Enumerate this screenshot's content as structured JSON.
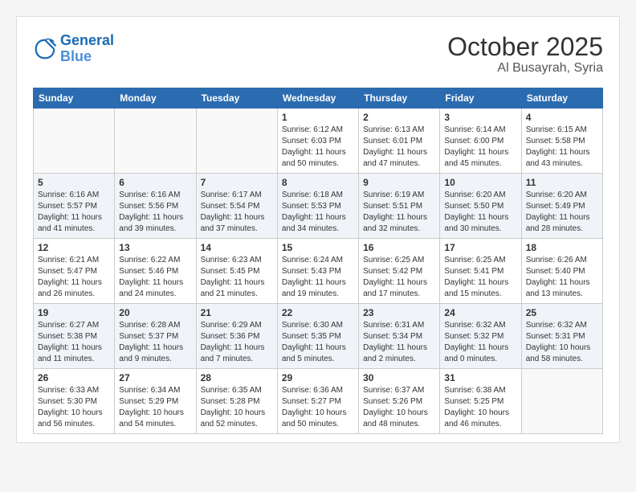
{
  "header": {
    "logo_line1": "General",
    "logo_line2": "Blue",
    "month": "October 2025",
    "location": "Al Busayrah, Syria"
  },
  "days_of_week": [
    "Sunday",
    "Monday",
    "Tuesday",
    "Wednesday",
    "Thursday",
    "Friday",
    "Saturday"
  ],
  "weeks": [
    [
      {
        "day": "",
        "content": ""
      },
      {
        "day": "",
        "content": ""
      },
      {
        "day": "",
        "content": ""
      },
      {
        "day": "1",
        "content": "Sunrise: 6:12 AM\nSunset: 6:03 PM\nDaylight: 11 hours and 50 minutes."
      },
      {
        "day": "2",
        "content": "Sunrise: 6:13 AM\nSunset: 6:01 PM\nDaylight: 11 hours and 47 minutes."
      },
      {
        "day": "3",
        "content": "Sunrise: 6:14 AM\nSunset: 6:00 PM\nDaylight: 11 hours and 45 minutes."
      },
      {
        "day": "4",
        "content": "Sunrise: 6:15 AM\nSunset: 5:58 PM\nDaylight: 11 hours and 43 minutes."
      }
    ],
    [
      {
        "day": "5",
        "content": "Sunrise: 6:16 AM\nSunset: 5:57 PM\nDaylight: 11 hours and 41 minutes."
      },
      {
        "day": "6",
        "content": "Sunrise: 6:16 AM\nSunset: 5:56 PM\nDaylight: 11 hours and 39 minutes."
      },
      {
        "day": "7",
        "content": "Sunrise: 6:17 AM\nSunset: 5:54 PM\nDaylight: 11 hours and 37 minutes."
      },
      {
        "day": "8",
        "content": "Sunrise: 6:18 AM\nSunset: 5:53 PM\nDaylight: 11 hours and 34 minutes."
      },
      {
        "day": "9",
        "content": "Sunrise: 6:19 AM\nSunset: 5:51 PM\nDaylight: 11 hours and 32 minutes."
      },
      {
        "day": "10",
        "content": "Sunrise: 6:20 AM\nSunset: 5:50 PM\nDaylight: 11 hours and 30 minutes."
      },
      {
        "day": "11",
        "content": "Sunrise: 6:20 AM\nSunset: 5:49 PM\nDaylight: 11 hours and 28 minutes."
      }
    ],
    [
      {
        "day": "12",
        "content": "Sunrise: 6:21 AM\nSunset: 5:47 PM\nDaylight: 11 hours and 26 minutes."
      },
      {
        "day": "13",
        "content": "Sunrise: 6:22 AM\nSunset: 5:46 PM\nDaylight: 11 hours and 24 minutes."
      },
      {
        "day": "14",
        "content": "Sunrise: 6:23 AM\nSunset: 5:45 PM\nDaylight: 11 hours and 21 minutes."
      },
      {
        "day": "15",
        "content": "Sunrise: 6:24 AM\nSunset: 5:43 PM\nDaylight: 11 hours and 19 minutes."
      },
      {
        "day": "16",
        "content": "Sunrise: 6:25 AM\nSunset: 5:42 PM\nDaylight: 11 hours and 17 minutes."
      },
      {
        "day": "17",
        "content": "Sunrise: 6:25 AM\nSunset: 5:41 PM\nDaylight: 11 hours and 15 minutes."
      },
      {
        "day": "18",
        "content": "Sunrise: 6:26 AM\nSunset: 5:40 PM\nDaylight: 11 hours and 13 minutes."
      }
    ],
    [
      {
        "day": "19",
        "content": "Sunrise: 6:27 AM\nSunset: 5:38 PM\nDaylight: 11 hours and 11 minutes."
      },
      {
        "day": "20",
        "content": "Sunrise: 6:28 AM\nSunset: 5:37 PM\nDaylight: 11 hours and 9 minutes."
      },
      {
        "day": "21",
        "content": "Sunrise: 6:29 AM\nSunset: 5:36 PM\nDaylight: 11 hours and 7 minutes."
      },
      {
        "day": "22",
        "content": "Sunrise: 6:30 AM\nSunset: 5:35 PM\nDaylight: 11 hours and 5 minutes."
      },
      {
        "day": "23",
        "content": "Sunrise: 6:31 AM\nSunset: 5:34 PM\nDaylight: 11 hours and 2 minutes."
      },
      {
        "day": "24",
        "content": "Sunrise: 6:32 AM\nSunset: 5:32 PM\nDaylight: 11 hours and 0 minutes."
      },
      {
        "day": "25",
        "content": "Sunrise: 6:32 AM\nSunset: 5:31 PM\nDaylight: 10 hours and 58 minutes."
      }
    ],
    [
      {
        "day": "26",
        "content": "Sunrise: 6:33 AM\nSunset: 5:30 PM\nDaylight: 10 hours and 56 minutes."
      },
      {
        "day": "27",
        "content": "Sunrise: 6:34 AM\nSunset: 5:29 PM\nDaylight: 10 hours and 54 minutes."
      },
      {
        "day": "28",
        "content": "Sunrise: 6:35 AM\nSunset: 5:28 PM\nDaylight: 10 hours and 52 minutes."
      },
      {
        "day": "29",
        "content": "Sunrise: 6:36 AM\nSunset: 5:27 PM\nDaylight: 10 hours and 50 minutes."
      },
      {
        "day": "30",
        "content": "Sunrise: 6:37 AM\nSunset: 5:26 PM\nDaylight: 10 hours and 48 minutes."
      },
      {
        "day": "31",
        "content": "Sunrise: 6:38 AM\nSunset: 5:25 PM\nDaylight: 10 hours and 46 minutes."
      },
      {
        "day": "",
        "content": ""
      }
    ]
  ]
}
